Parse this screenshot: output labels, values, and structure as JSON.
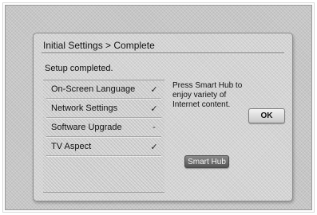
{
  "dialog": {
    "title": "Initial Settings > Complete",
    "status": "Setup completed.",
    "items": [
      {
        "label": "On-Screen Language",
        "mark": "✓"
      },
      {
        "label": "Network Settings",
        "mark": "✓"
      },
      {
        "label": "Software Upgrade",
        "mark": "-"
      },
      {
        "label": "TV Aspect",
        "mark": "✓"
      }
    ],
    "info": "Press Smart Hub to enjoy variety of Internet content.",
    "ok_label": "OK",
    "smart_hub_label": "Smart Hub"
  }
}
